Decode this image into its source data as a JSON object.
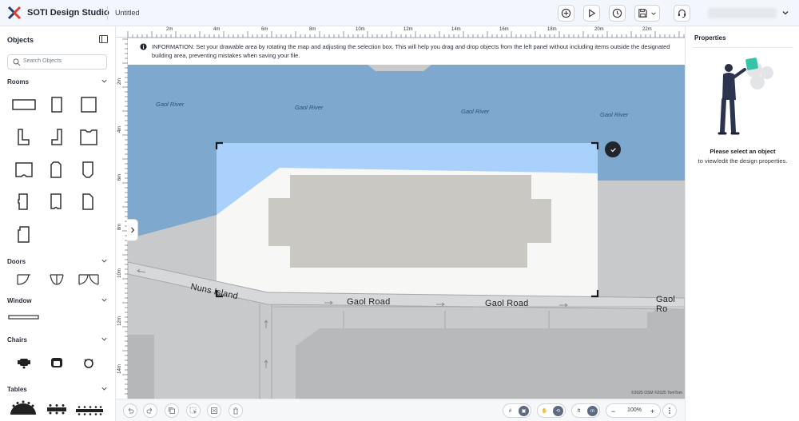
{
  "header": {
    "app_title": "SOTI Design Studio",
    "file_title": "Untitled",
    "toolbar": [
      "add-icon",
      "play-icon",
      "history-icon",
      "save-icon",
      "support-icon"
    ],
    "user_name": "blurred user"
  },
  "left_panel": {
    "title": "Objects",
    "search_placeholder": "Search Objects",
    "sections": {
      "rooms": "Rooms",
      "doors": "Doors",
      "window": "Window",
      "chairs": "Chairs",
      "tables": "Tables"
    }
  },
  "canvas": {
    "ruler_top": [
      "2m",
      "4m",
      "6m",
      "8m",
      "10m",
      "12m",
      "14m",
      "16m",
      "18m",
      "20m",
      "22m"
    ],
    "ruler_left": [
      "2m",
      "4m",
      "6m",
      "8m",
      "10m",
      "12m",
      "14m"
    ],
    "info_text": "INFORMATION: Set your drawable area by rotating the map and adjusting the selection box. This will help you drag and drop objects from the left panel without including items outside the designated building area, preventing mistakes when saving your file.",
    "river_labels": [
      "Gaol River",
      "Gaol River",
      "Gaol River",
      "Gaol River"
    ],
    "street_labels": {
      "nuns": "Nuns Island",
      "gaol1": "Gaol Road",
      "gaol2": "Gaol Road",
      "gaol3": "Gaol Ro"
    },
    "attribution": "©2025 OSM ©2025 TomTom",
    "colors": {
      "water": "#7fa8cf",
      "selection_water": "#a9d1fb",
      "land": "#c8c9cb",
      "building": "#c9c8c2",
      "selection": "#f7f7f6"
    }
  },
  "bottom_bar": {
    "unit_ft": "ft",
    "unit_m": "m",
    "zoom": "100%"
  },
  "right_panel": {
    "title": "Properties",
    "message": "Please select an object",
    "sub_message": "to view/edit the design properties."
  }
}
